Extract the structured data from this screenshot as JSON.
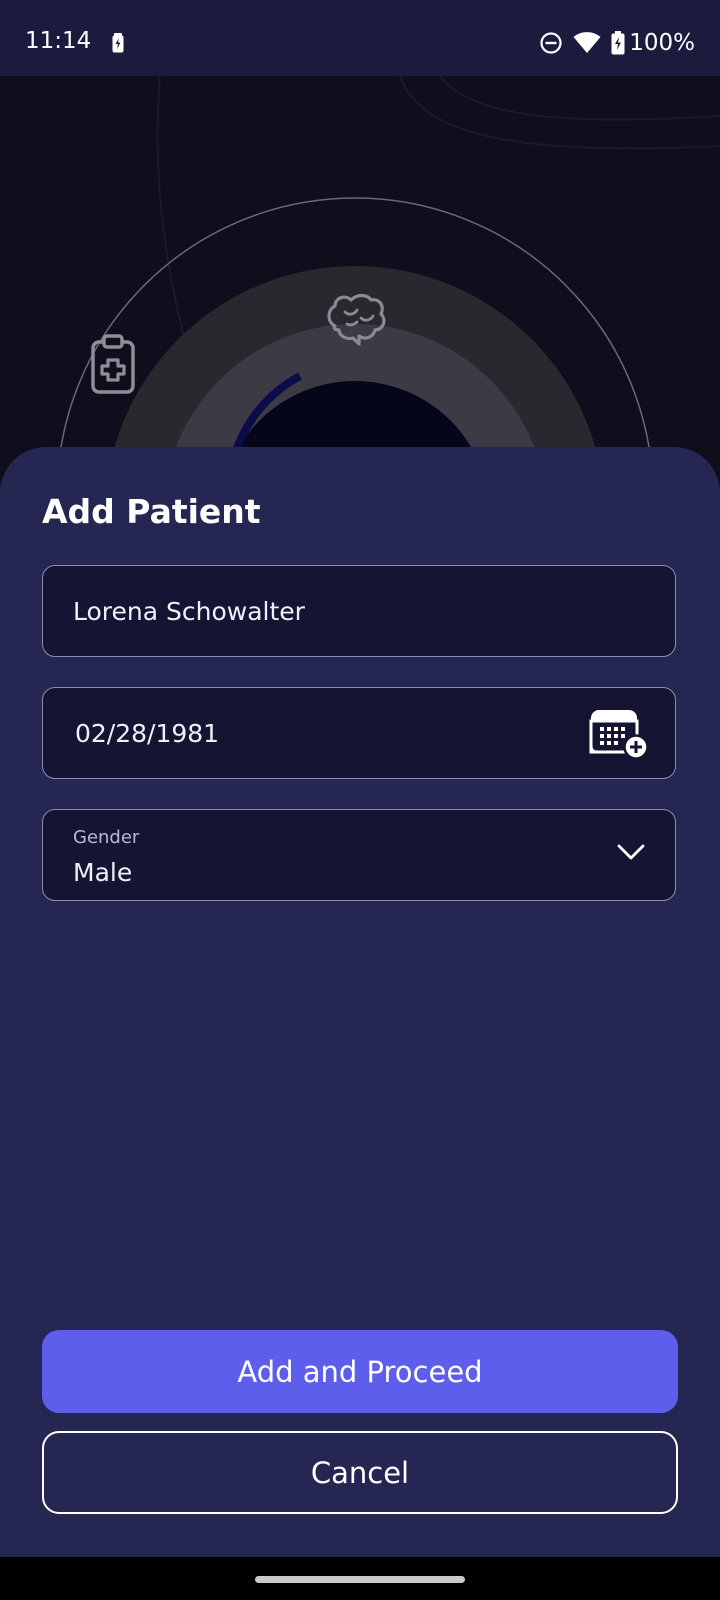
{
  "status_bar": {
    "time": "11:14",
    "battery_percent": "100%",
    "icons": [
      "battery-saver-icon",
      "do-not-disturb-icon",
      "wifi-icon",
      "battery-charging-icon"
    ]
  },
  "background": {
    "icons": [
      "clipboard-medical-icon",
      "brain-icon"
    ]
  },
  "sheet": {
    "title": "Add Patient",
    "name_field": {
      "value": "Lorena Schowalter"
    },
    "dob_field": {
      "value": "02/28/1981",
      "icon": "calendar-add-icon"
    },
    "gender_field": {
      "label": "Gender",
      "value": "Male",
      "icon": "chevron-down-icon"
    },
    "primary_button": "Add and Proceed",
    "secondary_button": "Cancel"
  },
  "colors": {
    "status_bar_bg": "#1b1b3e",
    "background": "#0e0e1c",
    "sheet_bg": "#262653",
    "field_bg": "#151533",
    "field_border": "#8c8caf",
    "primary": "#5e5eec"
  }
}
